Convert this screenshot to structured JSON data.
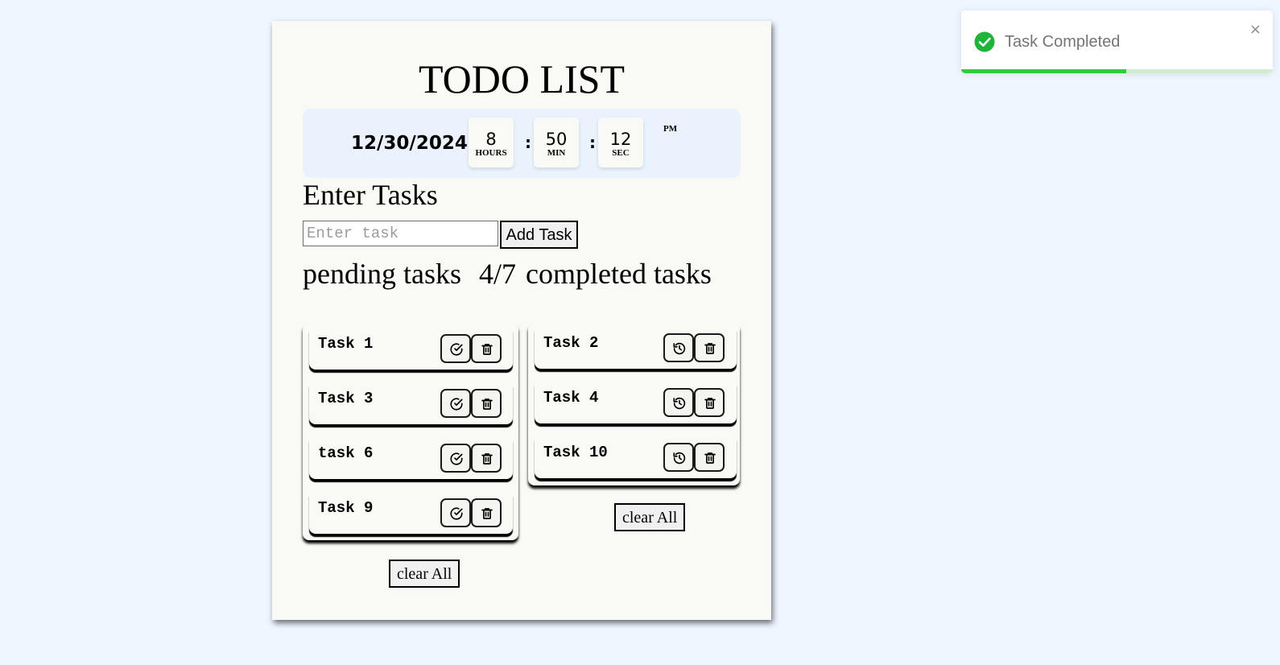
{
  "app": {
    "title": "TODO LIST"
  },
  "clock": {
    "date": "12/30/2024",
    "hours": "8",
    "hours_label": "HOURS",
    "minutes": "50",
    "minutes_label": "MIN",
    "seconds": "12",
    "seconds_label": "SEC",
    "separator": ":",
    "ampm": "PM"
  },
  "input_section": {
    "heading": "Enter Tasks",
    "placeholder": "Enter task",
    "value": "",
    "add_label": "Add Task"
  },
  "counter": {
    "pending_label": "pending tasks",
    "ratio": "4/7",
    "completed_label": "completed tasks"
  },
  "pending_tasks": [
    {
      "name": "Task 1"
    },
    {
      "name": "Task 3"
    },
    {
      "name": "task 6"
    },
    {
      "name": "Task 9"
    }
  ],
  "completed_tasks": [
    {
      "name": "Task 2"
    },
    {
      "name": "Task 4"
    },
    {
      "name": "Task 10"
    }
  ],
  "pending_clear_label": "clear All",
  "completed_clear_label": "clear All",
  "icons": {
    "complete": "check-circle-icon",
    "restore": "history-icon",
    "delete": "trash-icon",
    "success": "check-circle-filled-icon",
    "close": "close-icon"
  },
  "toast": {
    "message": "Task Completed",
    "close_symbol": "×",
    "progress": 0.53,
    "color": "#2ecc40"
  }
}
